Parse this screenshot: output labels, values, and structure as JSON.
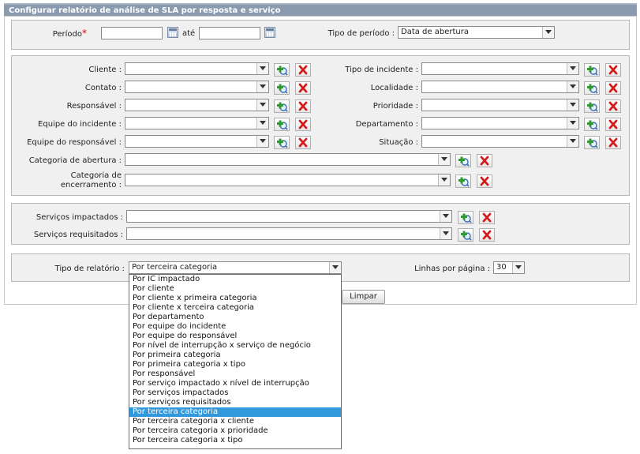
{
  "title": "Configurar relatório de análise de SLA por resposta e serviço",
  "period": {
    "label": "Período",
    "required_mark": "*",
    "until": "até",
    "start": "",
    "end": ""
  },
  "period_type": {
    "label": "Tipo de período :",
    "value": "Data de abertura"
  },
  "filters": {
    "cliente": {
      "label": "Cliente :",
      "value": ""
    },
    "contato": {
      "label": "Contato :",
      "value": ""
    },
    "responsavel": {
      "label": "Responsável :",
      "value": ""
    },
    "equipe_incidente": {
      "label": "Equipe do incidente :",
      "value": ""
    },
    "equipe_responsavel": {
      "label": "Equipe do responsável :",
      "value": ""
    },
    "tipo_incidente": {
      "label": "Tipo de incidente :",
      "value": ""
    },
    "localidade": {
      "label": "Localidade :",
      "value": ""
    },
    "prioridade": {
      "label": "Prioridade :",
      "value": ""
    },
    "departamento": {
      "label": "Departamento :",
      "value": ""
    },
    "situacao": {
      "label": "Situação :",
      "value": ""
    },
    "cat_abertura": {
      "label": "Categoria de abertura :",
      "value": ""
    },
    "cat_encerramento": {
      "label_line1": "Categoria de",
      "label_line2": "encerramento :",
      "value": ""
    }
  },
  "services": {
    "impactados": {
      "label": "Serviços impactados :",
      "value": ""
    },
    "requisitados": {
      "label": "Serviços requisitados :",
      "value": ""
    }
  },
  "report": {
    "type_label": "Tipo de relatório :",
    "type_value": "Por terceira categoria",
    "lines_label": "Linhas por página :",
    "lines_value": "30",
    "options": [
      "Por IC impactado",
      "Por cliente",
      "Por cliente x primeira categoria",
      "Por cliente x terceira categoria",
      "Por departamento",
      "Por equipe do incidente",
      "Por equipe do responsável",
      "Por nível de interrupção x serviço de negócio",
      "Por primeira categoria",
      "Por primeira categoria x tipo",
      "Por responsável",
      "Por serviço impactado x nível de interrupção",
      "Por serviços impactados",
      "Por serviços requisitados",
      "Por terceira categoria",
      "Por terceira categoria x cliente",
      "Por terceira categoria x prioridade",
      "Por terceira categoria x tipo"
    ],
    "selected_index": 14
  },
  "buttons": {
    "clear": "Limpar"
  },
  "icons": {
    "add": "add-search-icon",
    "remove": "remove-icon",
    "calendar": "calendar-icon"
  }
}
